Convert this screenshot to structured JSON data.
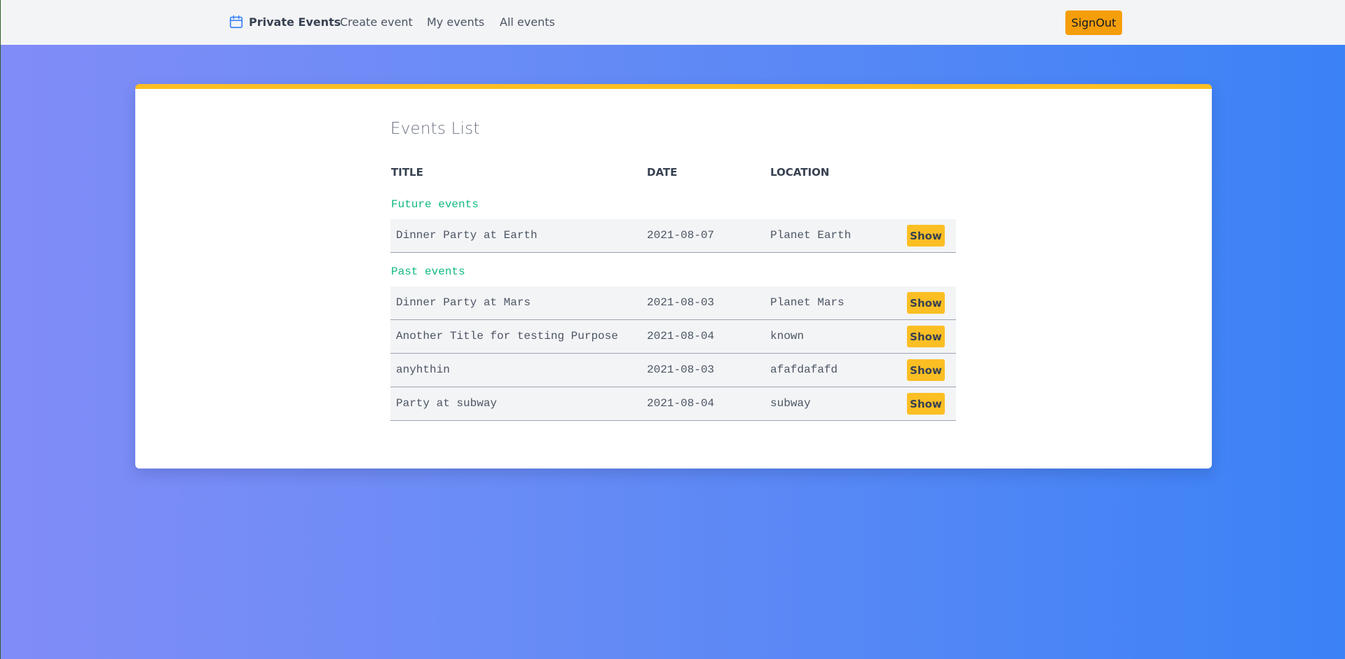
{
  "navbar": {
    "brand_icon": "calendar-icon",
    "brand": "Private Events",
    "links": [
      "Create event",
      "My events",
      "All events"
    ],
    "signout_label": "SignOut",
    "signout_color": "#f59e0b"
  },
  "main": {
    "title": "Events List",
    "columns": [
      "TITLE",
      "DATE",
      "LOCATION"
    ],
    "sections": [
      {
        "label": "Future events",
        "rows": [
          {
            "title": "Dinner Party at Earth",
            "date": "2021-08-07",
            "location": "Planet Earth",
            "action": "Show"
          }
        ]
      },
      {
        "label": "Past events",
        "rows": [
          {
            "title": "Dinner Party at Mars",
            "date": "2021-08-03",
            "location": "Planet Mars",
            "action": "Show"
          },
          {
            "title": "Another Title for testing Purpose",
            "date": "2021-08-04",
            "location": "known",
            "action": "Show"
          },
          {
            "title": "anyhthin",
            "date": "2021-08-03",
            "location": "afafdafafd",
            "action": "Show"
          },
          {
            "title": "Party at subway",
            "date": "2021-08-04",
            "location": "subway",
            "action": "Show"
          }
        ]
      }
    ]
  },
  "colors": {
    "accent": "#fbbf24",
    "section_label": "#10b981",
    "brand_icon": "#3b82f6"
  }
}
